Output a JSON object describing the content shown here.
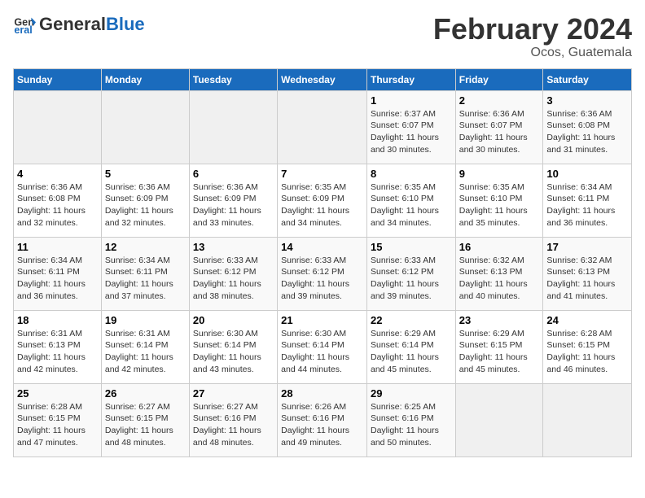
{
  "header": {
    "logo_general": "General",
    "logo_blue": "Blue",
    "month": "February 2024",
    "location": "Ocos, Guatemala"
  },
  "weekdays": [
    "Sunday",
    "Monday",
    "Tuesday",
    "Wednesday",
    "Thursday",
    "Friday",
    "Saturday"
  ],
  "weeks": [
    [
      {
        "day": "",
        "info": ""
      },
      {
        "day": "",
        "info": ""
      },
      {
        "day": "",
        "info": ""
      },
      {
        "day": "",
        "info": ""
      },
      {
        "day": "1",
        "info": "Sunrise: 6:37 AM\nSunset: 6:07 PM\nDaylight: 11 hours\nand 30 minutes."
      },
      {
        "day": "2",
        "info": "Sunrise: 6:36 AM\nSunset: 6:07 PM\nDaylight: 11 hours\nand 30 minutes."
      },
      {
        "day": "3",
        "info": "Sunrise: 6:36 AM\nSunset: 6:08 PM\nDaylight: 11 hours\nand 31 minutes."
      }
    ],
    [
      {
        "day": "4",
        "info": "Sunrise: 6:36 AM\nSunset: 6:08 PM\nDaylight: 11 hours\nand 32 minutes."
      },
      {
        "day": "5",
        "info": "Sunrise: 6:36 AM\nSunset: 6:09 PM\nDaylight: 11 hours\nand 32 minutes."
      },
      {
        "day": "6",
        "info": "Sunrise: 6:36 AM\nSunset: 6:09 PM\nDaylight: 11 hours\nand 33 minutes."
      },
      {
        "day": "7",
        "info": "Sunrise: 6:35 AM\nSunset: 6:09 PM\nDaylight: 11 hours\nand 34 minutes."
      },
      {
        "day": "8",
        "info": "Sunrise: 6:35 AM\nSunset: 6:10 PM\nDaylight: 11 hours\nand 34 minutes."
      },
      {
        "day": "9",
        "info": "Sunrise: 6:35 AM\nSunset: 6:10 PM\nDaylight: 11 hours\nand 35 minutes."
      },
      {
        "day": "10",
        "info": "Sunrise: 6:34 AM\nSunset: 6:11 PM\nDaylight: 11 hours\nand 36 minutes."
      }
    ],
    [
      {
        "day": "11",
        "info": "Sunrise: 6:34 AM\nSunset: 6:11 PM\nDaylight: 11 hours\nand 36 minutes."
      },
      {
        "day": "12",
        "info": "Sunrise: 6:34 AM\nSunset: 6:11 PM\nDaylight: 11 hours\nand 37 minutes."
      },
      {
        "day": "13",
        "info": "Sunrise: 6:33 AM\nSunset: 6:12 PM\nDaylight: 11 hours\nand 38 minutes."
      },
      {
        "day": "14",
        "info": "Sunrise: 6:33 AM\nSunset: 6:12 PM\nDaylight: 11 hours\nand 39 minutes."
      },
      {
        "day": "15",
        "info": "Sunrise: 6:33 AM\nSunset: 6:12 PM\nDaylight: 11 hours\nand 39 minutes."
      },
      {
        "day": "16",
        "info": "Sunrise: 6:32 AM\nSunset: 6:13 PM\nDaylight: 11 hours\nand 40 minutes."
      },
      {
        "day": "17",
        "info": "Sunrise: 6:32 AM\nSunset: 6:13 PM\nDaylight: 11 hours\nand 41 minutes."
      }
    ],
    [
      {
        "day": "18",
        "info": "Sunrise: 6:31 AM\nSunset: 6:13 PM\nDaylight: 11 hours\nand 42 minutes."
      },
      {
        "day": "19",
        "info": "Sunrise: 6:31 AM\nSunset: 6:14 PM\nDaylight: 11 hours\nand 42 minutes."
      },
      {
        "day": "20",
        "info": "Sunrise: 6:30 AM\nSunset: 6:14 PM\nDaylight: 11 hours\nand 43 minutes."
      },
      {
        "day": "21",
        "info": "Sunrise: 6:30 AM\nSunset: 6:14 PM\nDaylight: 11 hours\nand 44 minutes."
      },
      {
        "day": "22",
        "info": "Sunrise: 6:29 AM\nSunset: 6:14 PM\nDaylight: 11 hours\nand 45 minutes."
      },
      {
        "day": "23",
        "info": "Sunrise: 6:29 AM\nSunset: 6:15 PM\nDaylight: 11 hours\nand 45 minutes."
      },
      {
        "day": "24",
        "info": "Sunrise: 6:28 AM\nSunset: 6:15 PM\nDaylight: 11 hours\nand 46 minutes."
      }
    ],
    [
      {
        "day": "25",
        "info": "Sunrise: 6:28 AM\nSunset: 6:15 PM\nDaylight: 11 hours\nand 47 minutes."
      },
      {
        "day": "26",
        "info": "Sunrise: 6:27 AM\nSunset: 6:15 PM\nDaylight: 11 hours\nand 48 minutes."
      },
      {
        "day": "27",
        "info": "Sunrise: 6:27 AM\nSunset: 6:16 PM\nDaylight: 11 hours\nand 48 minutes."
      },
      {
        "day": "28",
        "info": "Sunrise: 6:26 AM\nSunset: 6:16 PM\nDaylight: 11 hours\nand 49 minutes."
      },
      {
        "day": "29",
        "info": "Sunrise: 6:25 AM\nSunset: 6:16 PM\nDaylight: 11 hours\nand 50 minutes."
      },
      {
        "day": "",
        "info": ""
      },
      {
        "day": "",
        "info": ""
      }
    ]
  ]
}
